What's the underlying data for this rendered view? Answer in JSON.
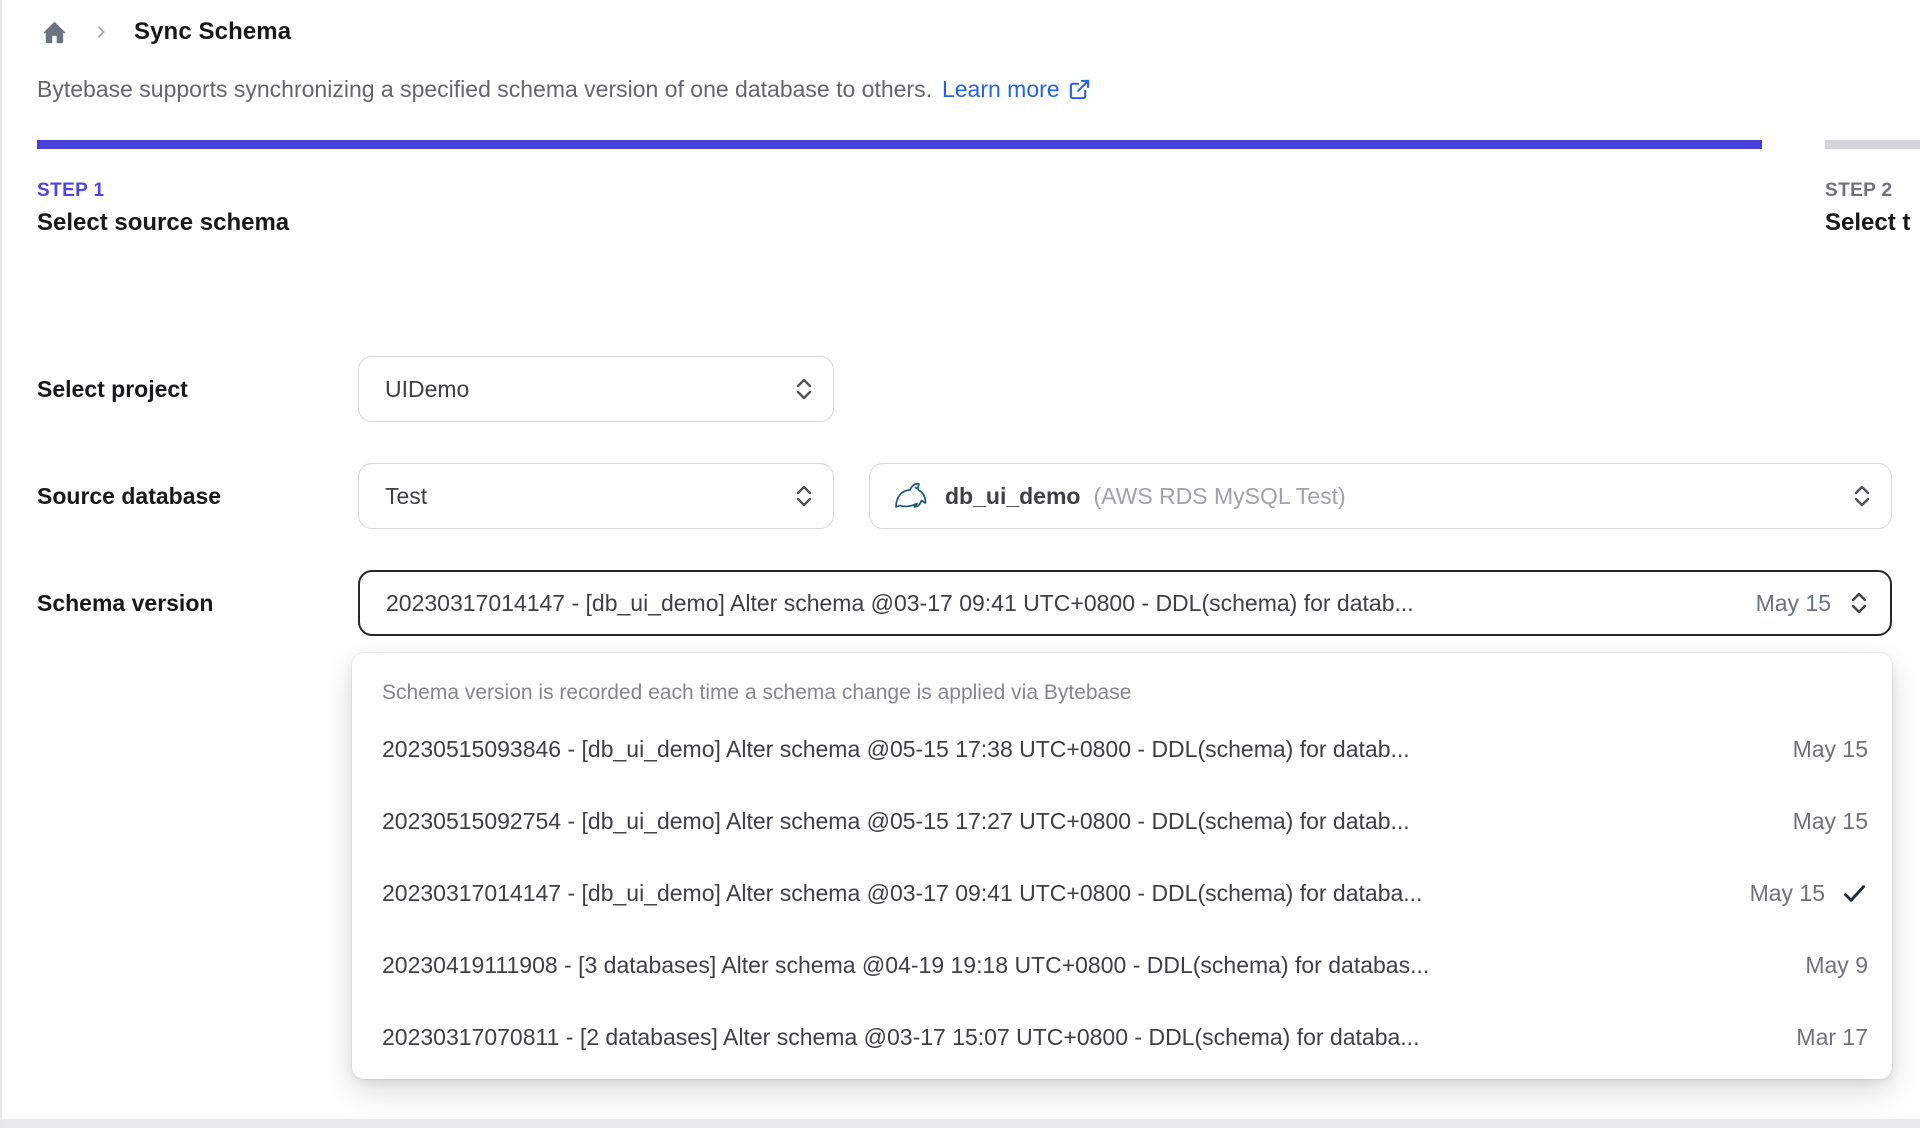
{
  "breadcrumb": {
    "home_icon": "home-icon",
    "separator_icon": "chevron-right-icon",
    "page_title": "Sync Schema"
  },
  "description": {
    "text": "Bytebase supports synchronizing a specified schema version of one database to others.",
    "link_label": "Learn more",
    "link_icon": "external-link-icon"
  },
  "steps": [
    {
      "label": "STEP 1",
      "title": "Select source schema",
      "active": true
    },
    {
      "label": "STEP 2",
      "title": "Select t",
      "active": false
    }
  ],
  "form": {
    "project_label": "Select project",
    "project_value": "UIDemo",
    "source_label": "Source database",
    "source_value": "Test",
    "database": {
      "engine_icon": "mysql-dolphin-icon",
      "name": "db_ui_demo",
      "detail": "(AWS RDS MySQL Test)"
    },
    "version_label": "Schema version",
    "version_value": "20230317014147 - [db_ui_demo] Alter schema @03-17 09:41 UTC+0800 - DDL(schema) for datab...",
    "version_date": "May 15"
  },
  "dropdown": {
    "header": "Schema version is recorded each time a schema change is applied via Bytebase",
    "options": [
      {
        "text": "20230515093846 - [db_ui_demo] Alter schema @05-15 17:38 UTC+0800 - DDL(schema) for datab...",
        "date": "May 15",
        "selected": false
      },
      {
        "text": "20230515092754 - [db_ui_demo] Alter schema @05-15 17:27 UTC+0800 - DDL(schema) for datab...",
        "date": "May 15",
        "selected": false
      },
      {
        "text": "20230317014147 - [db_ui_demo] Alter schema @03-17 09:41 UTC+0800 - DDL(schema) for databa...",
        "date": "May 15",
        "selected": true
      },
      {
        "text": "20230419111908 - [3 databases] Alter schema @04-19 19:18 UTC+0800 - DDL(schema) for databas...",
        "date": "May 9",
        "selected": false
      },
      {
        "text": "20230317070811 - [2 databases] Alter schema @03-17 15:07 UTC+0800 - DDL(schema) for databa...",
        "date": "Mar 17",
        "selected": false
      }
    ],
    "check_icon": "check-icon",
    "chevron_icon": "chevrons-up-down-icon"
  },
  "colors": {
    "accent": "#4f46e5",
    "progress_bar": "#4741d9",
    "inactive_bar": "#d4d4d8",
    "link": "#2563eb",
    "focus_border": "#27272a",
    "bottom_strip": "#e9eaec"
  }
}
